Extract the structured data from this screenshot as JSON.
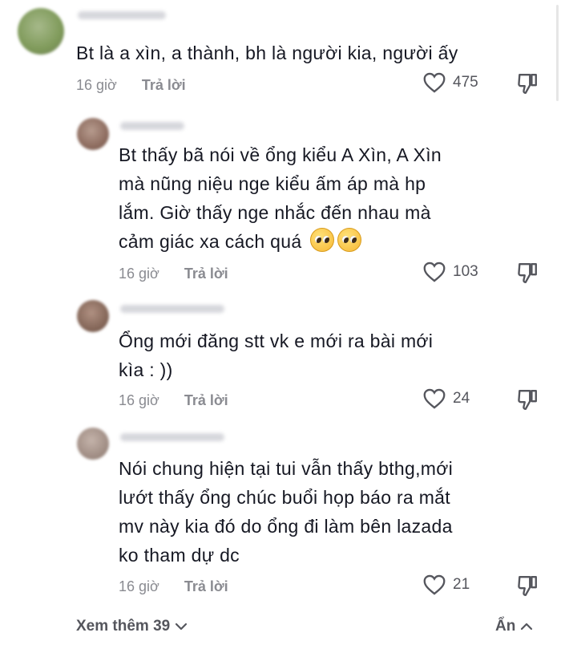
{
  "comments": [
    {
      "text": "Bt là a xìn, a thành, bh là người kia, người ấy",
      "time": "16 giờ",
      "reply_label": "Trả lời",
      "likes": "475",
      "avatar_color": "#8ca36a"
    },
    {
      "text_lines": [
        "Bt thấy bã nói về ổng kiểu A Xìn, A Xìn",
        "mà nũng niệu nge kiểu ấm áp mà hp",
        "lắm. Giờ thấy nge nhắc đến nhau mà",
        "cảm giác xa cách quá"
      ],
      "time": "16 giờ",
      "reply_label": "Trả lời",
      "likes": "103",
      "avatar_color": "#9c7a6e",
      "emoji": "pleading-face-icon"
    },
    {
      "text_lines": [
        "Ổng mới đăng stt vk e mới ra bài mới",
        "kìa : ))"
      ],
      "time": "16 giờ",
      "reply_label": "Trả lời",
      "likes": "24",
      "avatar_color": "#8e7466"
    },
    {
      "text_lines": [
        "Nói chung hiện tại tui vẫn thấy bthg,mới",
        "lướt thấy ổng chúc buổi họp báo ra mắt",
        "mv này kia đó do ổng đi làm bên lazada",
        "ko tham dự dc"
      ],
      "time": "16 giờ",
      "reply_label": "Trả lời",
      "likes": "21",
      "avatar_color": "#a7958c"
    }
  ],
  "footer": {
    "view_more": "Xem thêm 39",
    "hide": "Ẩn"
  },
  "colors": {
    "text": "#161823",
    "meta": "#8a8b91",
    "icon": "#55565d"
  }
}
